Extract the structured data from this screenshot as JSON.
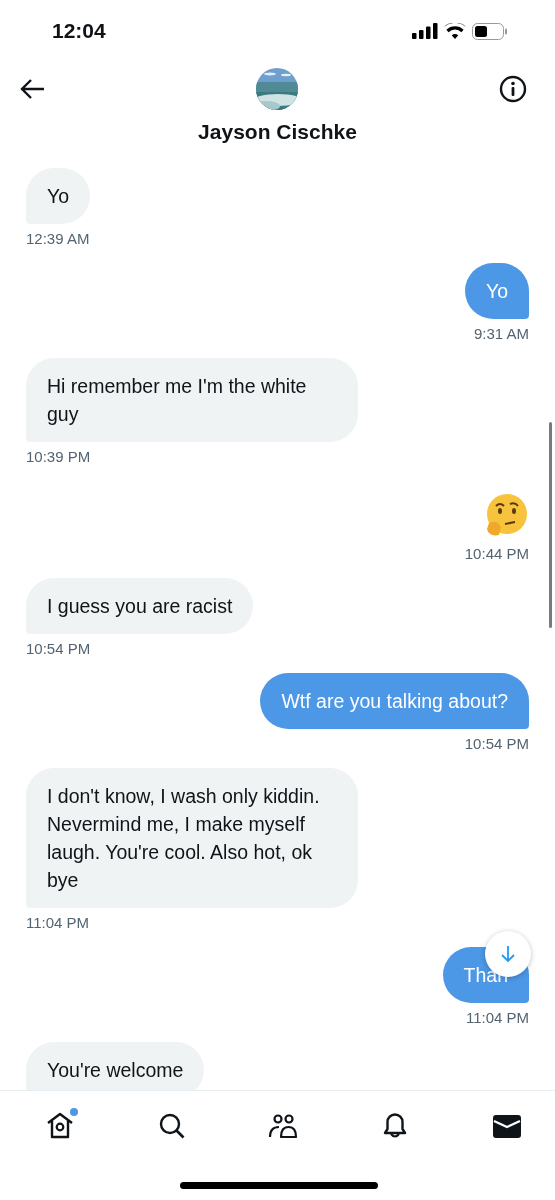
{
  "status_bar": {
    "time": "12:04"
  },
  "header": {
    "name": "Jayson Cischke"
  },
  "messages": [
    {
      "kind": "text",
      "outgoing": false,
      "text": "Yo",
      "time": "12:39 AM"
    },
    {
      "kind": "text",
      "outgoing": true,
      "text": "Yo",
      "time": "9:31 AM"
    },
    {
      "kind": "text",
      "outgoing": false,
      "text": "Hi remember me I'm the white guy",
      "time": "10:39 PM"
    },
    {
      "kind": "emoji",
      "outgoing": true,
      "time": "10:44 PM"
    },
    {
      "kind": "text",
      "outgoing": false,
      "text": "I guess you are racist",
      "time": "10:54 PM"
    },
    {
      "kind": "text",
      "outgoing": true,
      "text": "Wtf are you talking about?",
      "time": "10:54 PM"
    },
    {
      "kind": "text",
      "outgoing": false,
      "text": "I don't know, I wash only kiddin. Nevermind me, I make myself laugh. You're cool. Also hot, ok bye",
      "time": "11:04 PM"
    },
    {
      "kind": "text",
      "outgoing": true,
      "text": "Than",
      "time": "11:04 PM",
      "covered": true
    },
    {
      "kind": "text",
      "outgoing": false,
      "text": "You're welcome"
    }
  ],
  "nav": [
    {
      "kind": "home",
      "selected": false,
      "dot": true
    },
    {
      "kind": "search",
      "selected": false,
      "dot": false
    },
    {
      "kind": "people",
      "selected": false,
      "dot": false
    },
    {
      "kind": "bell",
      "selected": false,
      "dot": false
    },
    {
      "kind": "mail",
      "selected": true,
      "dot": false
    }
  ]
}
